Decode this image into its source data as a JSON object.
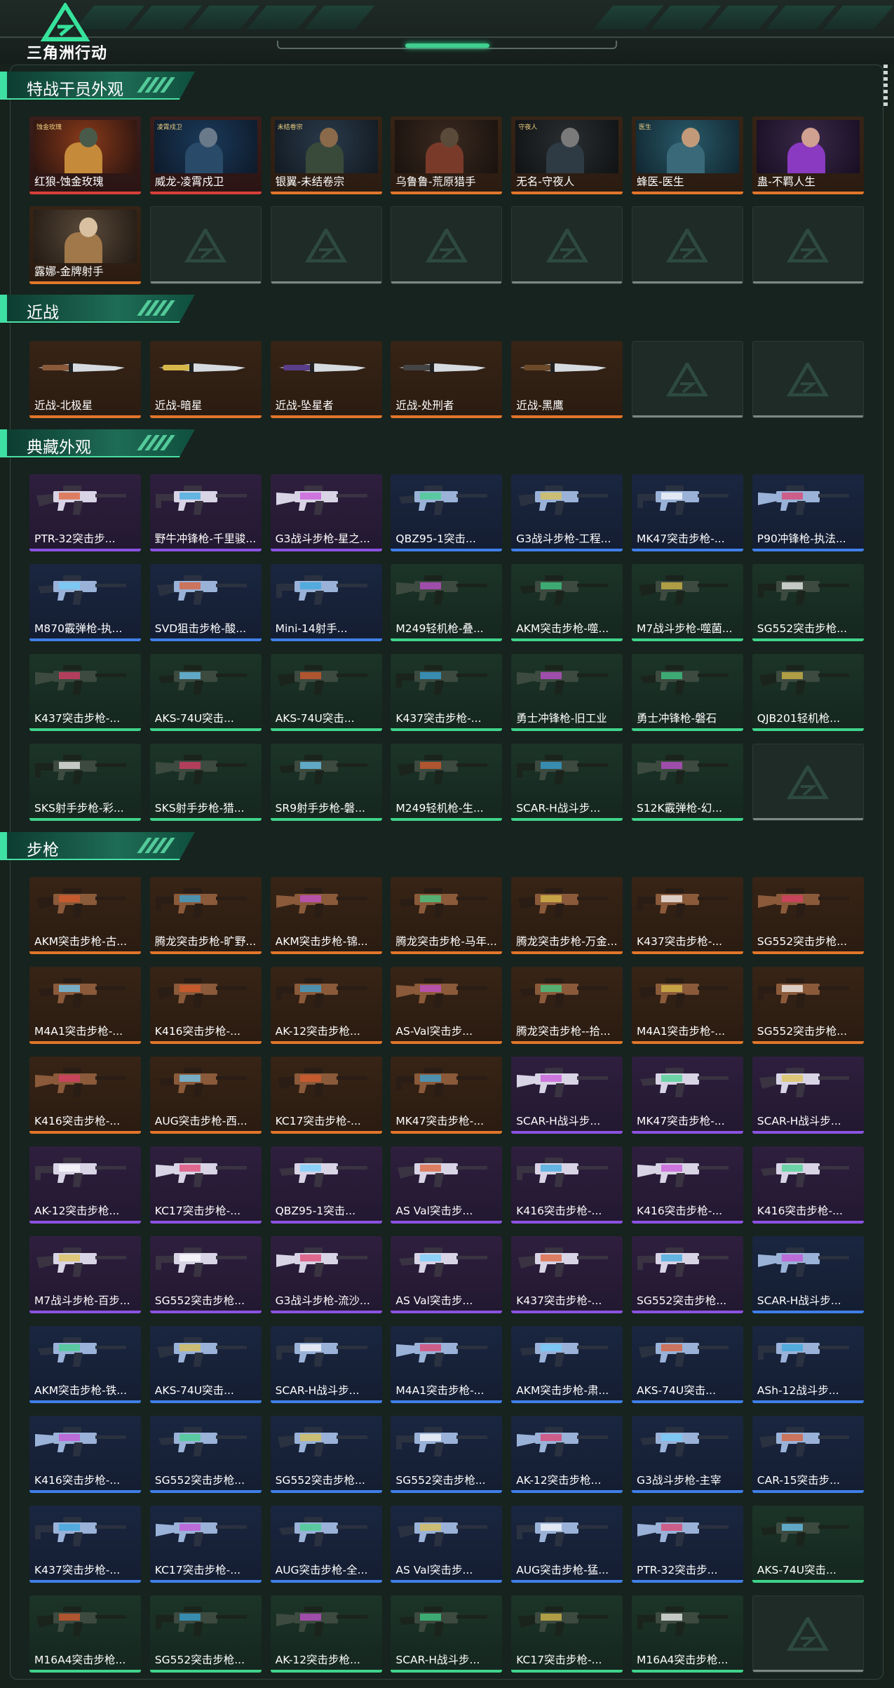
{
  "app": {
    "title": "三角洲行动"
  },
  "colors": {
    "accent": "#3fd08f",
    "red": "#d8403a",
    "orange": "#e1762b",
    "purple": "#8a52e0",
    "blue": "#3f7fe8",
    "green": "#3fd38a"
  },
  "sections": [
    {
      "title": "特战干员外观",
      "kind": "skin",
      "items": [
        {
          "name": "红狼-蚀金玫瑰",
          "tier": "red",
          "art_label": "蚀金玫瑰"
        },
        {
          "name": "威龙-凌霄戍卫",
          "tier": "red",
          "art_label": "凌霄戍卫"
        },
        {
          "name": "银翼-未结卷宗",
          "tier": "orange",
          "art_label": "未结卷宗"
        },
        {
          "name": "乌鲁鲁-荒原猎手",
          "tier": "orange",
          "art_label": ""
        },
        {
          "name": "无名-守夜人",
          "tier": "orange",
          "art_label": "守夜人"
        },
        {
          "name": "蜂医-医生",
          "tier": "orange",
          "art_label": "医生"
        },
        {
          "name": "蛊-不羁人生",
          "tier": "orange",
          "art_label": ""
        },
        {
          "name": "露娜-金牌射手",
          "tier": "orange",
          "art_label": ""
        },
        {
          "name": "",
          "tier": "empty"
        },
        {
          "name": "",
          "tier": "empty"
        },
        {
          "name": "",
          "tier": "empty"
        },
        {
          "name": "",
          "tier": "empty"
        },
        {
          "name": "",
          "tier": "empty"
        },
        {
          "name": "",
          "tier": "empty"
        }
      ]
    },
    {
      "title": "近战",
      "kind": "knife",
      "items": [
        {
          "name": "近战-北极星",
          "tier": "orange"
        },
        {
          "name": "近战-暗星",
          "tier": "orange"
        },
        {
          "name": "近战-坠星者",
          "tier": "orange"
        },
        {
          "name": "近战-处刑者",
          "tier": "orange"
        },
        {
          "name": "近战-黑鹰",
          "tier": "orange"
        },
        {
          "name": "",
          "tier": "empty"
        },
        {
          "name": "",
          "tier": "empty"
        }
      ]
    },
    {
      "title": "典藏外观",
      "kind": "gun",
      "items": [
        {
          "name": "PTR-32突击步...",
          "tier": "purple"
        },
        {
          "name": "野牛冲锋枪-千里骏...",
          "tier": "purple"
        },
        {
          "name": "G3战斗步枪-星之...",
          "tier": "purple"
        },
        {
          "name": "QBZ95-1突击...",
          "tier": "blue"
        },
        {
          "name": "G3战斗步枪-工程...",
          "tier": "blue"
        },
        {
          "name": "MK47突击步枪-...",
          "tier": "blue"
        },
        {
          "name": "P90冲锋枪-执法...",
          "tier": "blue"
        },
        {
          "name": "M870霰弹枪-执...",
          "tier": "blue"
        },
        {
          "name": "SVD狙击步枪-酸...",
          "tier": "blue"
        },
        {
          "name": "Mini-14射手...",
          "tier": "blue"
        },
        {
          "name": "M249轻机枪-叠...",
          "tier": "green"
        },
        {
          "name": "AKM突击步枪-噬...",
          "tier": "green"
        },
        {
          "name": "M7战斗步枪-噬菌...",
          "tier": "green"
        },
        {
          "name": "SG552突击步枪...",
          "tier": "green"
        },
        {
          "name": "K437突击步枪-...",
          "tier": "green"
        },
        {
          "name": "AKS-74U突击...",
          "tier": "green"
        },
        {
          "name": "AKS-74U突击...",
          "tier": "green"
        },
        {
          "name": "K437突击步枪-...",
          "tier": "green"
        },
        {
          "name": "勇士冲锋枪-旧工业",
          "tier": "green"
        },
        {
          "name": "勇士冲锋枪-磐石",
          "tier": "green"
        },
        {
          "name": "QJB201轻机枪...",
          "tier": "green"
        },
        {
          "name": "SKS射手步枪-彩...",
          "tier": "green"
        },
        {
          "name": "SKS射手步枪-猎...",
          "tier": "green"
        },
        {
          "name": "SR9射手步枪-磐...",
          "tier": "green"
        },
        {
          "name": "M249轻机枪-生...",
          "tier": "green"
        },
        {
          "name": "SCAR-H战斗步...",
          "tier": "green"
        },
        {
          "name": "S12K霰弹枪-幻...",
          "tier": "green"
        },
        {
          "name": "",
          "tier": "empty"
        }
      ]
    },
    {
      "title": "步枪",
      "kind": "gun",
      "items": [
        {
          "name": "AKM突击步枪-古...",
          "tier": "orange"
        },
        {
          "name": "腾龙突击步枪-旷野...",
          "tier": "orange"
        },
        {
          "name": "AKM突击步枪-锦...",
          "tier": "orange"
        },
        {
          "name": "腾龙突击步枪-马年...",
          "tier": "orange"
        },
        {
          "name": "腾龙突击步枪-万金...",
          "tier": "orange"
        },
        {
          "name": "K437突击步枪-...",
          "tier": "orange"
        },
        {
          "name": "SG552突击步枪...",
          "tier": "orange"
        },
        {
          "name": "M4A1突击步枪-...",
          "tier": "orange"
        },
        {
          "name": "K416突击步枪-...",
          "tier": "orange"
        },
        {
          "name": "AK-12突击步枪...",
          "tier": "orange"
        },
        {
          "name": "AS-Val突击步...",
          "tier": "orange"
        },
        {
          "name": "腾龙突击步枪--拾...",
          "tier": "orange"
        },
        {
          "name": "M4A1突击步枪-...",
          "tier": "orange"
        },
        {
          "name": "SG552突击步枪...",
          "tier": "orange"
        },
        {
          "name": "K416突击步枪-...",
          "tier": "orange"
        },
        {
          "name": "AUG突击步枪-西...",
          "tier": "orange"
        },
        {
          "name": "KC17突击步枪-...",
          "tier": "orange"
        },
        {
          "name": "MK47突击步枪-...",
          "tier": "orange"
        },
        {
          "name": "SCAR-H战斗步...",
          "tier": "purple"
        },
        {
          "name": "MK47突击步枪-...",
          "tier": "purple"
        },
        {
          "name": "SCAR-H战斗步...",
          "tier": "purple"
        },
        {
          "name": "AK-12突击步枪...",
          "tier": "purple"
        },
        {
          "name": "KC17突击步枪-...",
          "tier": "purple"
        },
        {
          "name": "QBZ95-1突击...",
          "tier": "purple"
        },
        {
          "name": "AS Val突击步...",
          "tier": "purple"
        },
        {
          "name": "K416突击步枪-...",
          "tier": "purple"
        },
        {
          "name": "K416突击步枪-...",
          "tier": "purple"
        },
        {
          "name": "K416突击步枪-...",
          "tier": "purple"
        },
        {
          "name": "M7战斗步枪-百步...",
          "tier": "purple"
        },
        {
          "name": "SG552突击步枪...",
          "tier": "purple"
        },
        {
          "name": "G3战斗步枪-流沙...",
          "tier": "purple"
        },
        {
          "name": "AS Val突击步...",
          "tier": "purple"
        },
        {
          "name": "K437突击步枪-...",
          "tier": "purple"
        },
        {
          "name": "SG552突击步枪...",
          "tier": "purple"
        },
        {
          "name": "SCAR-H战斗步...",
          "tier": "blue"
        },
        {
          "name": "AKM突击步枪-铁...",
          "tier": "blue"
        },
        {
          "name": "AKS-74U突击...",
          "tier": "blue"
        },
        {
          "name": "SCAR-H战斗步...",
          "tier": "blue"
        },
        {
          "name": "M4A1突击步枪-...",
          "tier": "blue"
        },
        {
          "name": "AKM突击步枪-肃...",
          "tier": "blue"
        },
        {
          "name": "AKS-74U突击...",
          "tier": "blue"
        },
        {
          "name": "ASh-12战斗步...",
          "tier": "blue"
        },
        {
          "name": "K416突击步枪-...",
          "tier": "blue"
        },
        {
          "name": "SG552突击步枪...",
          "tier": "blue"
        },
        {
          "name": "SG552突击步枪...",
          "tier": "blue"
        },
        {
          "name": "SG552突击步枪...",
          "tier": "blue"
        },
        {
          "name": "AK-12突击步枪...",
          "tier": "blue"
        },
        {
          "name": "G3战斗步枪-主宰",
          "tier": "blue"
        },
        {
          "name": "CAR-15突击步...",
          "tier": "blue"
        },
        {
          "name": "K437突击步枪-...",
          "tier": "blue"
        },
        {
          "name": "KC17突击步枪-...",
          "tier": "blue"
        },
        {
          "name": "AUG突击步枪-全...",
          "tier": "blue"
        },
        {
          "name": "AS Val突击步...",
          "tier": "blue"
        },
        {
          "name": "AUG突击步枪-猛...",
          "tier": "blue"
        },
        {
          "name": "PTR-32突击步...",
          "tier": "blue"
        },
        {
          "name": "AKS-74U突击...",
          "tier": "green"
        },
        {
          "name": "M16A4突击步枪...",
          "tier": "green"
        },
        {
          "name": "SG552突击步枪...",
          "tier": "green"
        },
        {
          "name": "AK-12突击步枪...",
          "tier": "green"
        },
        {
          "name": "SCAR-H战斗步...",
          "tier": "green"
        },
        {
          "name": "KC17突击步枪-...",
          "tier": "green"
        },
        {
          "name": "M16A4突击步枪...",
          "tier": "green"
        },
        {
          "name": "",
          "tier": "empty"
        }
      ]
    }
  ]
}
